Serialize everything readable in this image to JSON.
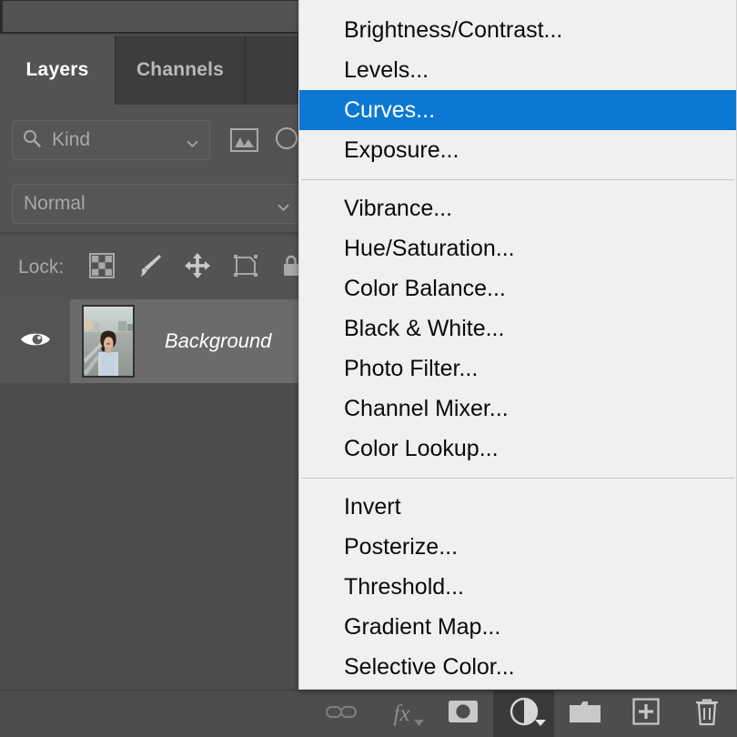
{
  "panel": {
    "tabs": [
      {
        "label": "Layers",
        "active": true
      },
      {
        "label": "Channels",
        "active": false
      }
    ],
    "filter": {
      "search_icon": "search-icon",
      "kind_value": "Kind",
      "kind_placeholder": "Kind",
      "chevron_icon": "chevron-down-icon",
      "filter_type_icons": [
        "image-filter-icon",
        "adjustment-filter-icon"
      ]
    },
    "blend_mode": {
      "value": "Normal",
      "chevron_icon": "chevron-down-icon"
    },
    "lock": {
      "label": "Lock:",
      "icons": [
        "transparent-pixels-icon",
        "image-pixels-brush-icon",
        "position-move-icon",
        "artboard-nesting-icon",
        "lock-all-icon"
      ]
    },
    "layers": [
      {
        "name": "Background",
        "visible": true,
        "visibility_icon": "eye-icon",
        "selected": true,
        "thumbnail": "portrait-photo-thumbnail"
      }
    ],
    "bottom_toolbar": [
      {
        "name": "link-layers-button",
        "icon": "link-icon",
        "label": "",
        "active": false,
        "disabled": true
      },
      {
        "name": "layer-style-button",
        "icon": "fx-icon",
        "label": "fx",
        "active": false,
        "disabled": true
      },
      {
        "name": "add-layer-mask-button",
        "icon": "layer-mask-icon",
        "label": "",
        "active": false,
        "disabled": false
      },
      {
        "name": "new-adjustment-layer-button",
        "icon": "half-circle-adjustment-icon",
        "label": "",
        "active": true,
        "disabled": false
      },
      {
        "name": "new-group-button",
        "icon": "folder-icon",
        "label": "",
        "active": false,
        "disabled": false
      },
      {
        "name": "new-layer-button",
        "icon": "plus-square-icon",
        "label": "",
        "active": false,
        "disabled": false
      },
      {
        "name": "delete-layer-button",
        "icon": "trash-icon",
        "label": "",
        "active": false,
        "disabled": false
      }
    ]
  },
  "adjustment_menu": {
    "groups": [
      {
        "items": [
          {
            "label": "Brightness/Contrast...",
            "highlighted": false
          },
          {
            "label": "Levels...",
            "highlighted": false
          },
          {
            "label": "Curves...",
            "highlighted": true
          },
          {
            "label": "Exposure...",
            "highlighted": false
          }
        ]
      },
      {
        "items": [
          {
            "label": "Vibrance...",
            "highlighted": false
          },
          {
            "label": "Hue/Saturation...",
            "highlighted": false
          },
          {
            "label": "Color Balance...",
            "highlighted": false
          },
          {
            "label": "Black & White...",
            "highlighted": false
          },
          {
            "label": "Photo Filter...",
            "highlighted": false
          },
          {
            "label": "Channel Mixer...",
            "highlighted": false
          },
          {
            "label": "Color Lookup...",
            "highlighted": false
          }
        ]
      },
      {
        "items": [
          {
            "label": "Invert",
            "highlighted": false
          },
          {
            "label": "Posterize...",
            "highlighted": false
          },
          {
            "label": "Threshold...",
            "highlighted": false
          },
          {
            "label": "Gradient Map...",
            "highlighted": false
          },
          {
            "label": "Selective Color...",
            "highlighted": false
          }
        ]
      }
    ]
  },
  "colors": {
    "panel_bg": "#4d4d4d",
    "panel_header_bg": "#535353",
    "tab_inactive_bg": "#3d3d3d",
    "layer_selected_bg": "#6b6b6b",
    "menu_bg": "#f0f0f0",
    "menu_highlight": "#0c78d4",
    "menu_text": "#0a0a0a",
    "menu_highlight_text": "#ffffff",
    "icon_gray": "#a8a8a8"
  }
}
